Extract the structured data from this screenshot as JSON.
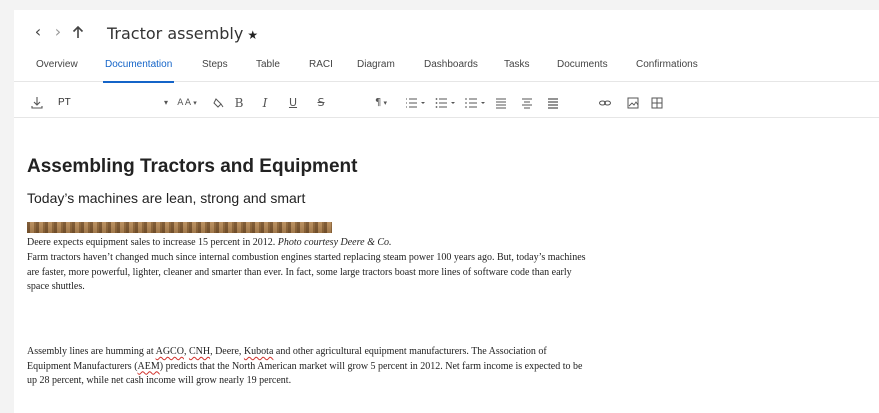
{
  "header": {
    "title": "Tractor assembly",
    "favorite_icon": "star-icon",
    "nav": {
      "back": "back-arrow-icon",
      "forward": "forward-arrow-icon",
      "up": "up-arrow-icon"
    }
  },
  "tabs": [
    {
      "label": "Overview",
      "active": false
    },
    {
      "label": "Documentation",
      "active": true
    },
    {
      "label": "Steps",
      "active": false
    },
    {
      "label": "Table",
      "active": false
    },
    {
      "label": "RACI",
      "active": false
    },
    {
      "label": "Diagram",
      "active": false
    },
    {
      "label": "Dashboards",
      "active": false
    },
    {
      "label": "Tasks",
      "active": false
    },
    {
      "label": "Documents",
      "active": false
    },
    {
      "label": "Confirmations",
      "active": false
    }
  ],
  "toolbar": {
    "font_family": "PT",
    "icons": [
      "download-icon",
      "font-size-icon",
      "fill-color-icon",
      "bold-icon",
      "italic-icon",
      "underline-icon",
      "strikethrough-icon",
      "paragraph-icon",
      "ordered-list-icon",
      "bullet-list-icon",
      "align-left-icon",
      "align-center-icon",
      "align-justify-icon",
      "link-icon",
      "image-icon",
      "table-icon"
    ],
    "font_size_glyph": "A A"
  },
  "document": {
    "heading": "Assembling Tractors and Equipment",
    "subheading": "Today’s machines are lean, strong and smart",
    "caption_text": "Deere expects equipment sales to increase 15 percent in 2012. ",
    "caption_credit": "Photo courtesy Deere & Co.",
    "paragraph1": [
      "Farm tractors haven’t changed much since internal combustion engines started replacing steam power 100 years ago. But, today’s machines",
      "are faster, more powerful, lighter, cleaner and smarter than ever. In fact, some large tractors boast more lines of software code than early",
      "space shuttles."
    ],
    "paragraph2": {
      "line1_a": "Assembly lines are humming at ",
      "agco": "AGCO",
      "sep1": ", ",
      "cnh": "CNH",
      "line1_b": ", Deere, ",
      "kubota": "Kubota",
      "line1_c": " and other agricultural equipment manufacturers. The Association of",
      "line2_a": "Equipment Manufacturers (",
      "aem": "AEM",
      "line2_b": ") predicts that the North American market will grow 5 percent in 2012. Net farm income is expected to be",
      "line3": "up 28 percent, while net cash income will grow nearly 19 percent."
    }
  },
  "colors": {
    "accent": "#1464c8",
    "spellcheck": "#d0302a",
    "background": "#f3f3f3"
  }
}
